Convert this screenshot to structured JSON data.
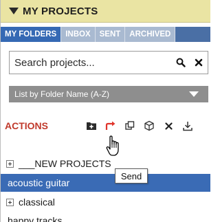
{
  "header": {
    "title": "MY PROJECTS"
  },
  "tabs": [
    {
      "label": "MY FOLDERS",
      "active": true
    },
    {
      "label": "INBOX",
      "active": false
    },
    {
      "label": "SENT",
      "active": false
    },
    {
      "label": "ARCHIVED",
      "active": false
    }
  ],
  "search": {
    "placeholder": "Search projects..."
  },
  "sort": {
    "selected": "List by Folder Name (A-Z)"
  },
  "actions": {
    "label": "ACTIONS",
    "icons": [
      "new-folder-icon",
      "send-icon",
      "duplicate-icon",
      "package-icon",
      "delete-icon",
      "download-icon"
    ]
  },
  "tooltip": {
    "text": "Send"
  },
  "tree": [
    {
      "label": "___NEW PROJECTS",
      "expandable": true,
      "selected": false
    },
    {
      "label": "acoustic guitar",
      "expandable": false,
      "selected": true
    },
    {
      "label": "classical",
      "expandable": true,
      "selected": false
    },
    {
      "label": "happy tracks",
      "expandable": false,
      "selected": false
    }
  ],
  "colors": {
    "header_bg": "#eae4a3",
    "tab_active": "#3569b4",
    "tab_inactive": "#a9bad1",
    "selected_row": "#3a6bb5",
    "actions_label": "#c0392b",
    "send_icon": "#e0342b"
  }
}
